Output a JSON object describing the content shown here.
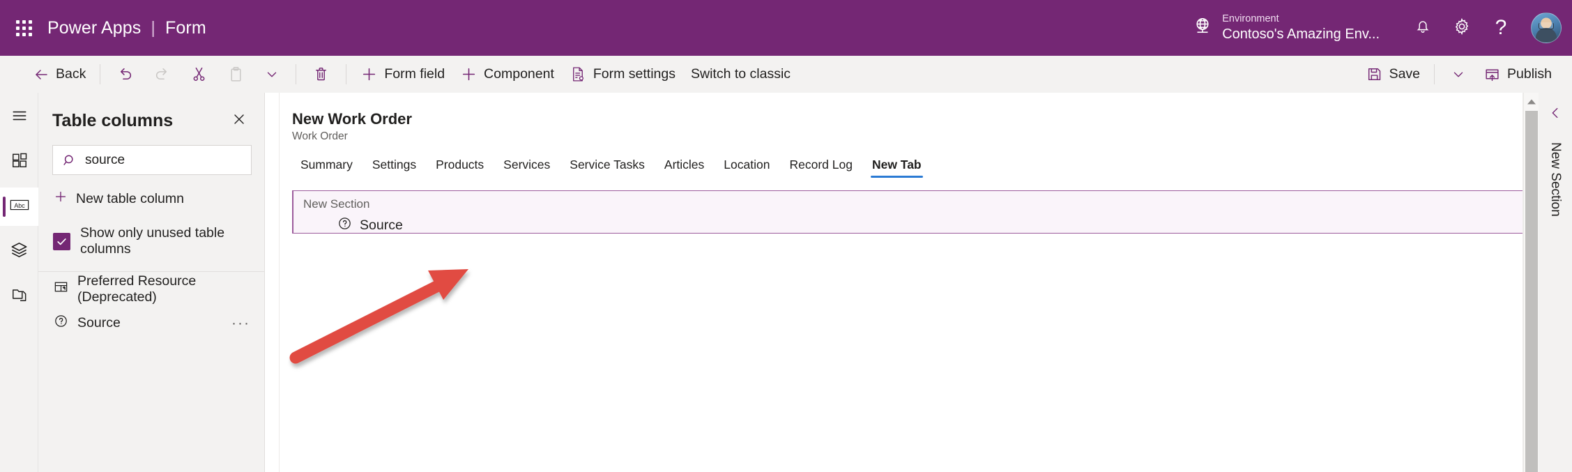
{
  "suitebar": {
    "waffle_label": "App launcher",
    "app_name": "Power Apps",
    "separator": "|",
    "page_name": "Form",
    "environment_label": "Environment",
    "environment_name": "Contoso's Amazing Env...",
    "globe_icon": "globe-icon",
    "notification_icon": "bell-icon",
    "settings_icon": "gear-icon",
    "help_icon": "question-mark-icon",
    "avatar_name": "user-avatar",
    "background_color": "#742774"
  },
  "commandbar": {
    "back": "Back",
    "undo_icon": "undo-icon",
    "redo_icon": "redo-icon",
    "cut_icon": "scissors-icon",
    "paste_icon": "clipboard-icon",
    "more_caret_icon": "chevron-down-icon",
    "delete_icon": "trash-icon",
    "form_field": "Form field",
    "component": "Component",
    "form_settings": "Form settings",
    "switch_to_classic": "Switch to classic",
    "save": "Save",
    "save_caret_icon": "chevron-down-icon",
    "publish": "Publish"
  },
  "rail": {
    "items": [
      {
        "name": "menu-icon",
        "label": "Menu",
        "selected": false
      },
      {
        "name": "components-icon",
        "label": "Components",
        "selected": false
      },
      {
        "name": "abc-icon",
        "label": "Table columns",
        "selected": true
      },
      {
        "name": "layers-icon",
        "label": "Tree view",
        "selected": false
      },
      {
        "name": "copy-icon",
        "label": "Related",
        "selected": false
      }
    ]
  },
  "panel": {
    "title": "Table columns",
    "close_icon": "close-icon",
    "search": {
      "value": "source",
      "placeholder": "Search",
      "search_icon": "search-icon",
      "clear_icon": "close-icon",
      "filter_icon": "filter-icon",
      "filter_caret_icon": "chevron-down-icon"
    },
    "new_column": "New table column",
    "new_column_icon": "plus-icon",
    "checkbox": {
      "label": "Show only unused table columns",
      "checked": true,
      "check_icon": "checkmark-icon",
      "color": "#742774"
    },
    "columns": [
      {
        "label": "Preferred Resource (Deprecated)",
        "icon": "lookup-table-icon",
        "overflow": ""
      },
      {
        "label": "Source",
        "icon": "question-choice-icon",
        "overflow": "···"
      }
    ]
  },
  "form": {
    "title": "New Work Order",
    "subtitle": "Work Order",
    "tabs": [
      {
        "label": "Summary",
        "active": false
      },
      {
        "label": "Settings",
        "active": false
      },
      {
        "label": "Products",
        "active": false
      },
      {
        "label": "Services",
        "active": false
      },
      {
        "label": "Service Tasks",
        "active": false
      },
      {
        "label": "Articles",
        "active": false
      },
      {
        "label": "Location",
        "active": false
      },
      {
        "label": "Record Log",
        "active": false
      },
      {
        "label": "New Tab",
        "active": true
      }
    ],
    "active_tab_underline_color": "#2a7ad4",
    "section": {
      "label": "New Section",
      "border_color": "#9c5b9c",
      "background_color": "#faf4fa",
      "field": {
        "label": "Source",
        "icon": "question-choice-icon"
      }
    }
  },
  "scrollbar": {
    "up_arrow_icon": "caret-up-icon",
    "thumb_color": "#c0bfbd"
  },
  "right_rail": {
    "collapse_icon": "chevron-left-icon",
    "label": "New Section"
  },
  "annotation": {
    "arrow_color": "#e14b42",
    "description": "red-arrow-pointing-to-source-field"
  }
}
